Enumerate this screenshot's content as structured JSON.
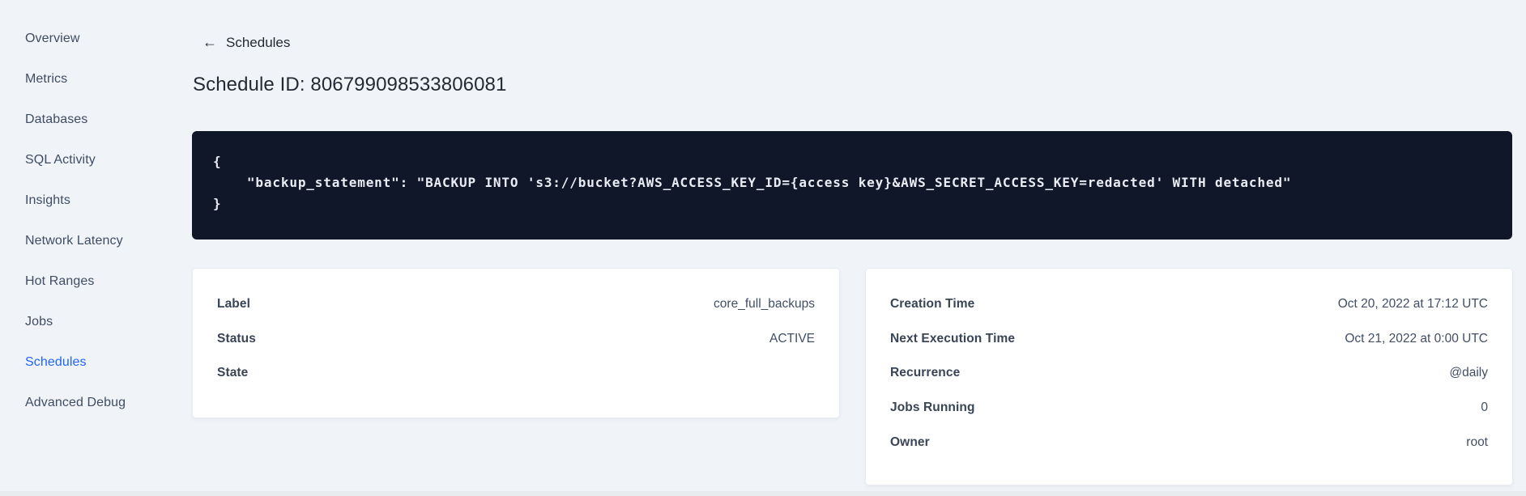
{
  "sidebar": {
    "items": [
      {
        "label": "Overview",
        "active": false
      },
      {
        "label": "Metrics",
        "active": false
      },
      {
        "label": "Databases",
        "active": false
      },
      {
        "label": "SQL Activity",
        "active": false
      },
      {
        "label": "Insights",
        "active": false
      },
      {
        "label": "Network Latency",
        "active": false
      },
      {
        "label": "Hot Ranges",
        "active": false
      },
      {
        "label": "Jobs",
        "active": false
      },
      {
        "label": "Schedules",
        "active": true
      },
      {
        "label": "Advanced Debug",
        "active": false
      }
    ]
  },
  "header": {
    "back_icon": "←",
    "back_label": "Schedules",
    "title": "Schedule ID: 806799098533806081"
  },
  "code_block": {
    "lines": [
      "{",
      "    \"backup_statement\": \"BACKUP INTO 's3://bucket?AWS_ACCESS_KEY_ID={access key}&AWS_SECRET_ACCESS_KEY=redacted' WITH detached\"",
      "}"
    ]
  },
  "left_card": {
    "rows": [
      {
        "label": "Label",
        "value": "core_full_backups"
      },
      {
        "label": "Status",
        "value": "ACTIVE"
      },
      {
        "label": "State",
        "value": ""
      }
    ]
  },
  "right_card": {
    "rows": [
      {
        "label": "Creation Time",
        "value": "Oct 20, 2022 at 17:12 UTC"
      },
      {
        "label": "Next Execution Time",
        "value": "Oct 21, 2022 at 0:00 UTC"
      },
      {
        "label": "Recurrence",
        "value": "@daily"
      },
      {
        "label": "Jobs Running",
        "value": "0"
      },
      {
        "label": "Owner",
        "value": "root"
      }
    ]
  },
  "colors": {
    "page_background": "#f0f4f8",
    "accent_blue": "#2264f5",
    "code_block_background": "#101729",
    "code_text": "#e9edf3",
    "heading_text": "#242a35",
    "nav_text": "#3f4d63",
    "card_background": "#ffffff"
  }
}
